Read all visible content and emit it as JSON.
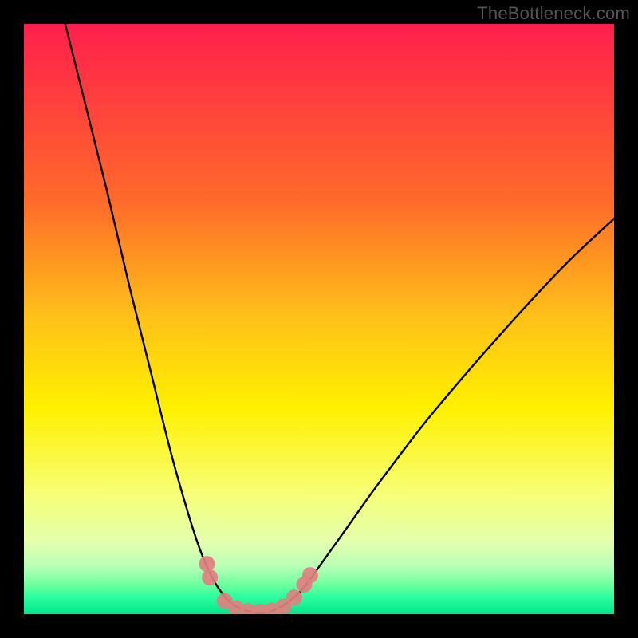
{
  "watermark": "TheBottleneck.com",
  "chart_data": {
    "type": "line",
    "title": "",
    "xlabel": "",
    "ylabel": "",
    "xlim": [
      0,
      100
    ],
    "ylim": [
      0,
      100
    ],
    "grid": false,
    "legend": false,
    "gradient_bands": [
      {
        "y": 0,
        "color": "#ff1f4d"
      },
      {
        "y": 30,
        "color": "#ff6a2a"
      },
      {
        "y": 50,
        "color": "#ffc218"
      },
      {
        "y": 65,
        "color": "#fff000"
      },
      {
        "y": 80,
        "color": "#f6ff7a"
      },
      {
        "y": 88,
        "color": "#e3ffb0"
      },
      {
        "y": 92,
        "color": "#b6ffb6"
      },
      {
        "y": 95,
        "color": "#6fff9e"
      },
      {
        "y": 97,
        "color": "#2fffa0"
      },
      {
        "y": 100,
        "color": "#00e58b"
      }
    ],
    "series": [
      {
        "name": "left-curve",
        "stroke": "#000000",
        "points": [
          {
            "x": 7.0,
            "y": 100.0
          },
          {
            "x": 10.0,
            "y": 88.0
          },
          {
            "x": 14.0,
            "y": 72.0
          },
          {
            "x": 18.0,
            "y": 55.0
          },
          {
            "x": 22.0,
            "y": 39.0
          },
          {
            "x": 25.0,
            "y": 27.0
          },
          {
            "x": 28.0,
            "y": 16.5
          },
          {
            "x": 30.0,
            "y": 10.5
          },
          {
            "x": 32.0,
            "y": 6.0
          },
          {
            "x": 34.0,
            "y": 3.0
          },
          {
            "x": 36.0,
            "y": 1.3
          },
          {
            "x": 38.0,
            "y": 0.5
          },
          {
            "x": 40.0,
            "y": 0.0
          }
        ]
      },
      {
        "name": "right-curve",
        "stroke": "#000000",
        "points": [
          {
            "x": 40.0,
            "y": 0.0
          },
          {
            "x": 42.0,
            "y": 0.5
          },
          {
            "x": 44.0,
            "y": 1.5
          },
          {
            "x": 47.0,
            "y": 4.0
          },
          {
            "x": 50.0,
            "y": 8.0
          },
          {
            "x": 55.0,
            "y": 15.0
          },
          {
            "x": 60.0,
            "y": 22.0
          },
          {
            "x": 68.0,
            "y": 32.5
          },
          {
            "x": 76.0,
            "y": 42.0
          },
          {
            "x": 84.0,
            "y": 51.0
          },
          {
            "x": 92.0,
            "y": 59.5
          },
          {
            "x": 100.0,
            "y": 67.0
          }
        ]
      },
      {
        "name": "bottom-markers",
        "type": "scatter",
        "color": "#e08080",
        "radius": 10,
        "points": [
          {
            "x": 31.0,
            "y": 8.5
          },
          {
            "x": 31.5,
            "y": 6.2
          },
          {
            "x": 34.0,
            "y": 2.2
          },
          {
            "x": 36.0,
            "y": 1.0
          },
          {
            "x": 38.0,
            "y": 0.5
          },
          {
            "x": 40.0,
            "y": 0.4
          },
          {
            "x": 42.0,
            "y": 0.6
          },
          {
            "x": 44.0,
            "y": 1.3
          },
          {
            "x": 45.8,
            "y": 2.8
          },
          {
            "x": 47.5,
            "y": 5.0
          },
          {
            "x": 48.5,
            "y": 6.6
          }
        ]
      }
    ]
  }
}
